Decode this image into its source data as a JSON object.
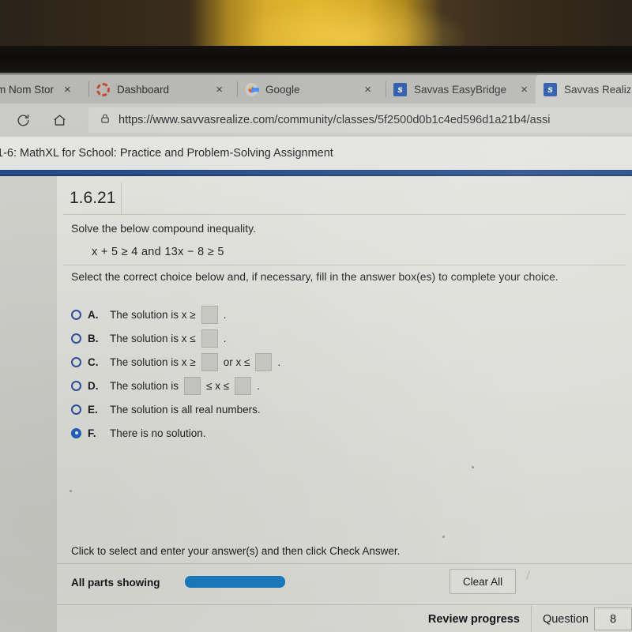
{
  "browser": {
    "tabs": [
      {
        "title": "m Nom Stor",
        "favicon": "nomnom-icon",
        "active": false,
        "close_label": "×"
      },
      {
        "title": "Dashboard",
        "favicon": "dashboard-icon",
        "active": false,
        "close_label": "×"
      },
      {
        "title": "Google",
        "favicon": "google-icon",
        "active": false,
        "close_label": "×"
      },
      {
        "title": "Savvas EasyBridge",
        "favicon": "savvas-icon",
        "active": false,
        "close_label": "×"
      },
      {
        "title": "Savvas Realize",
        "favicon": "savvas-icon",
        "active": true,
        "close_label": ""
      }
    ],
    "favicon_letter": "s",
    "reload_icon": "reload-icon",
    "home_icon": "home-icon",
    "lock_icon": "lock-icon",
    "url": "https://www.savvasrealize.com/community/classes/5f2500d0b1c4ed596d1a21b4/assi"
  },
  "page": {
    "title": "1-6: MathXL for School: Practice and Problem-Solving Assignment",
    "accent_blue": "#204a90"
  },
  "question": {
    "number": "1.6.21",
    "prompt": "Solve the below compound inequality.",
    "expression": "x + 5 ≥ 4 and 13x − 8 ≥ 5",
    "instruction": "Select the correct choice below and, if necessary, fill in the answer box(es) to complete your choice.",
    "choices": [
      {
        "letter": "A.",
        "pre": "The solution is x ≥",
        "boxes": 1,
        "mid": "",
        "post": ".",
        "selected": false
      },
      {
        "letter": "B.",
        "pre": "The solution is x ≤",
        "boxes": 1,
        "mid": "",
        "post": ".",
        "selected": false
      },
      {
        "letter": "C.",
        "pre": "The solution is x ≥",
        "boxes": 2,
        "mid": "or x ≤",
        "post": ".",
        "selected": false
      },
      {
        "letter": "D.",
        "pre": "The solution is",
        "boxes": 2,
        "mid": "≤ x ≤",
        "post": ".",
        "selected": false
      },
      {
        "letter": "E.",
        "pre": "The solution is all real numbers.",
        "boxes": 0,
        "mid": "",
        "post": "",
        "selected": false
      },
      {
        "letter": "F.",
        "pre": "There is no solution.",
        "boxes": 0,
        "mid": "",
        "post": "",
        "selected": true
      }
    ]
  },
  "footer": {
    "hint": "Click to select and enter your answer(s) and then click Check Answer.",
    "all_parts_label": "All parts showing",
    "clear_all_label": "Clear All",
    "progress_color": "#1b80c6",
    "review_progress_label": "Review progress",
    "question_label": "Question",
    "question_value": "8"
  }
}
